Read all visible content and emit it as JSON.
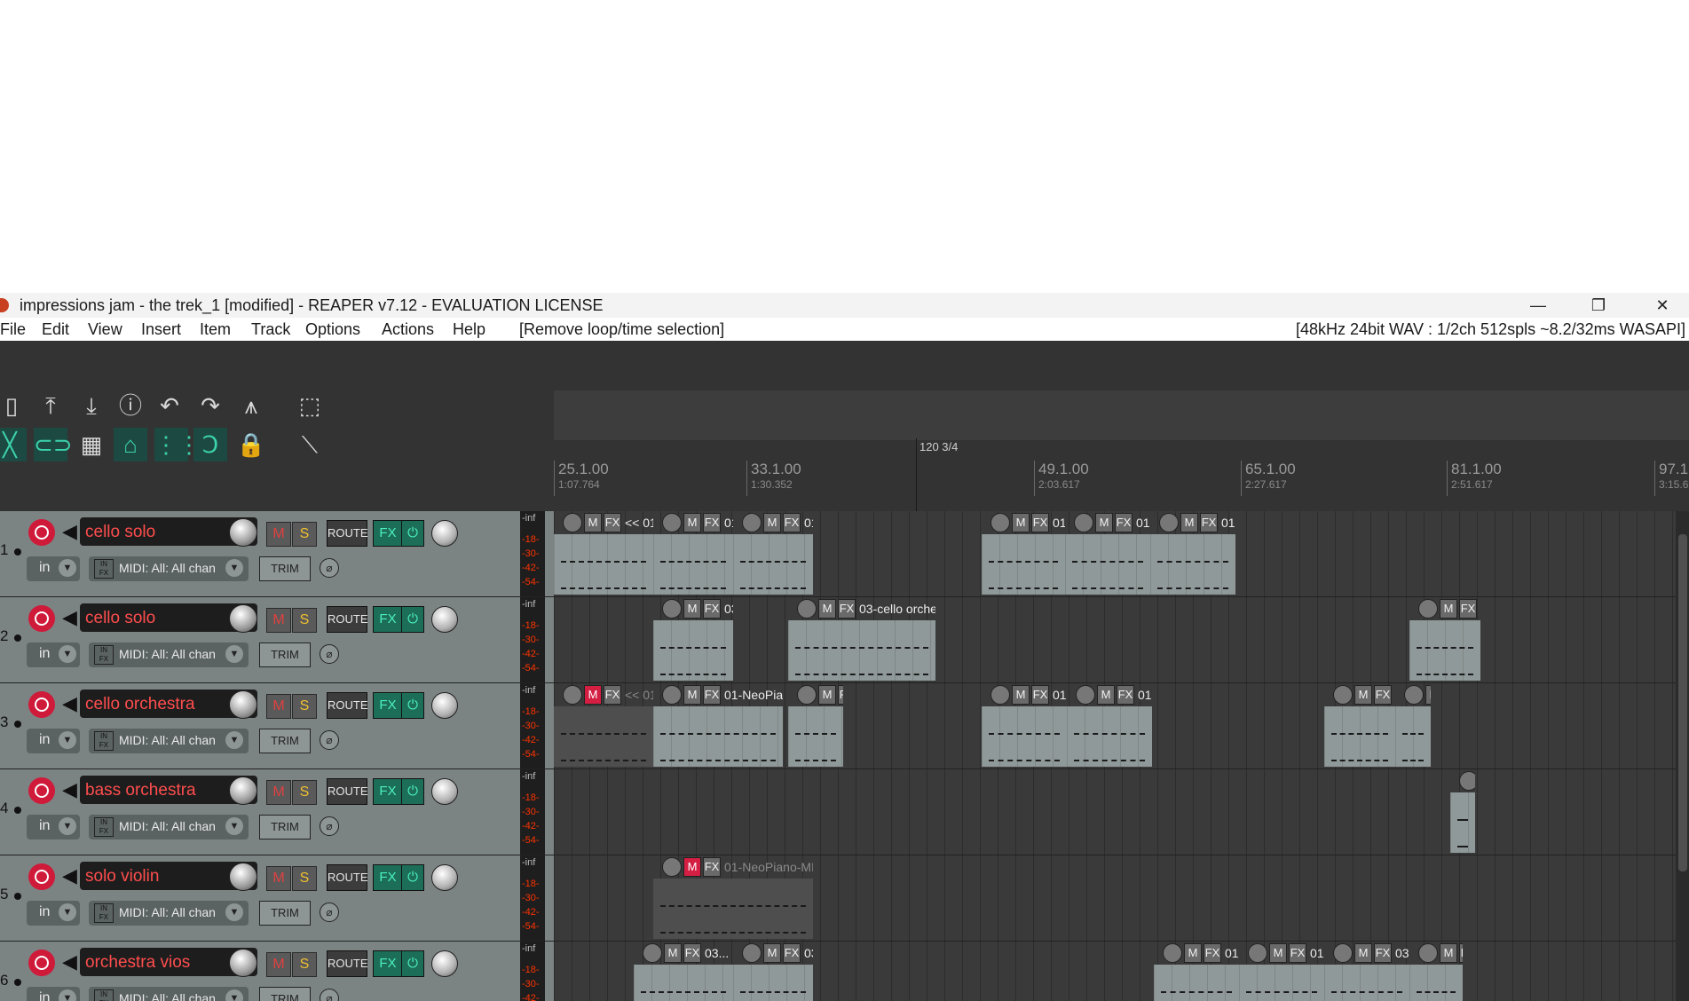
{
  "window": {
    "title": "impressions jam - the trek_1 [modified] - REAPER v7.12 - EVALUATION LICENSE",
    "controls": [
      "—",
      "❐",
      "✕"
    ]
  },
  "menu": {
    "items": [
      "File",
      "Edit",
      "View",
      "Insert",
      "Item",
      "Track",
      "Options",
      "Actions",
      "Help"
    ],
    "action_hint": "[Remove loop/time selection]",
    "audio_info": "[48kHz 24bit WAV : 1/2ch 512spls ~8.2/32ms WASAPI]"
  },
  "toolbar": {
    "row1_icons": [
      "new-project-icon",
      "upload-icon",
      "download-icon",
      "info-icon",
      "undo-icon",
      "redo-icon",
      "metronome-icon",
      "selection-rect-icon"
    ],
    "row2_icons": [
      "ripple-icon",
      "link-icon",
      "grid-icon",
      "group-link-icon",
      "snap-grid-icon",
      "snap-magnet-icon",
      "lock-icon",
      "envelope-icon"
    ]
  },
  "tempo_marker": "120 3/4",
  "ruler": [
    {
      "bar": "25.1.00",
      "time": "1:07.764"
    },
    {
      "bar": "33.1.00",
      "time": "1:30.352"
    },
    {
      "bar": "49.1.00",
      "time": "2:03.617"
    },
    {
      "bar": "65.1.00",
      "time": "2:27.617"
    },
    {
      "bar": "81.1.00",
      "time": "2:51.617"
    },
    {
      "bar": "97.1",
      "time": "3:15.6"
    }
  ],
  "tracks": [
    {
      "num": "1",
      "name": "cello solo",
      "input": "in",
      "midi": "MIDI: All: All chan",
      "m": "M",
      "s": "S",
      "route": "ROUTE",
      "fx": "FX",
      "pwr": "⏻",
      "trim": "TRIM",
      "phase": "⌀",
      "meter": [
        "-inf",
        "-18-",
        "-30-",
        "-42-",
        "-54-"
      ],
      "items": [
        {
          "label": "<< 01-..."
        },
        {
          "label": "01..."
        },
        {
          "label": "01..."
        },
        {
          "label": "01-..."
        },
        {
          "label": "01-NeoPiano-MIDI-gl..."
        },
        {
          "label": "01-..."
        }
      ]
    },
    {
      "num": "2",
      "name": "cello solo",
      "input": "in",
      "midi": "MIDI: All: All chan",
      "m": "M",
      "s": "S",
      "route": "ROUTE",
      "fx": "FX",
      "pwr": "⏻",
      "trim": "TRIM",
      "phase": "⌀",
      "meter": [
        "-inf",
        "-18-",
        "-30-",
        "-42-",
        "-54-"
      ],
      "items": [
        {
          "label": "03..."
        },
        {
          "label": "03-cello orchest..."
        },
        {
          "label": ""
        }
      ]
    },
    {
      "num": "3",
      "name": "cello orchestra",
      "input": "in",
      "midi": "MIDI: All: All chan",
      "m": "M",
      "s": "S",
      "route": "ROUTE",
      "fx": "FX",
      "pwr": "⏻",
      "trim": "TRIM",
      "phase": "⌀",
      "meter": [
        "-inf",
        "-18-",
        "-30-",
        "-42-",
        "-54-"
      ],
      "items": [
        {
          "label": "<< 01-..."
        },
        {
          "label": "01-NeoPiano..."
        },
        {
          "label": "0..."
        },
        {
          "label": "01-..."
        },
        {
          "label": "01-..."
        },
        {
          "label": "03-..."
        },
        {
          "label": ""
        }
      ]
    },
    {
      "num": "4",
      "name": "bass orchestra",
      "input": "in",
      "midi": "MIDI: All: All chan",
      "m": "M",
      "s": "S",
      "route": "ROUTE",
      "fx": "FX",
      "pwr": "⏻",
      "trim": "TRIM",
      "phase": "⌀",
      "meter": [
        "-inf",
        "-18-",
        "-30-",
        "-42-",
        "-54-"
      ],
      "items": [
        {
          "label": ""
        }
      ]
    },
    {
      "num": "5",
      "name": "solo violin",
      "input": "in",
      "midi": "MIDI: All: All chan",
      "m": "M",
      "s": "S",
      "route": "ROUTE",
      "fx": "FX",
      "pwr": "⏻",
      "trim": "TRIM",
      "phase": "⌀",
      "meter": [
        "-inf",
        "-18-",
        "-30-",
        "-42-",
        "-54-"
      ],
      "items": [
        {
          "label": "01-NeoPiano-MIDI-..."
        }
      ]
    },
    {
      "num": "6",
      "name": "orchestra vios",
      "input": "in",
      "midi": "MIDI: All: All chan",
      "m": "M",
      "s": "S",
      "route": "ROUTE",
      "fx": "FX",
      "pwr": "⏻",
      "trim": "TRIM",
      "phase": "⌀",
      "meter": [
        "-inf",
        "-18-",
        "-30-",
        "-42-",
        "-54-"
      ],
      "items": [
        {
          "label": "03..."
        },
        {
          "label": "03..."
        },
        {
          "label": "01-..."
        },
        {
          "label": "01-..."
        },
        {
          "label": "03-..."
        },
        {
          "label": "0"
        }
      ]
    }
  ]
}
